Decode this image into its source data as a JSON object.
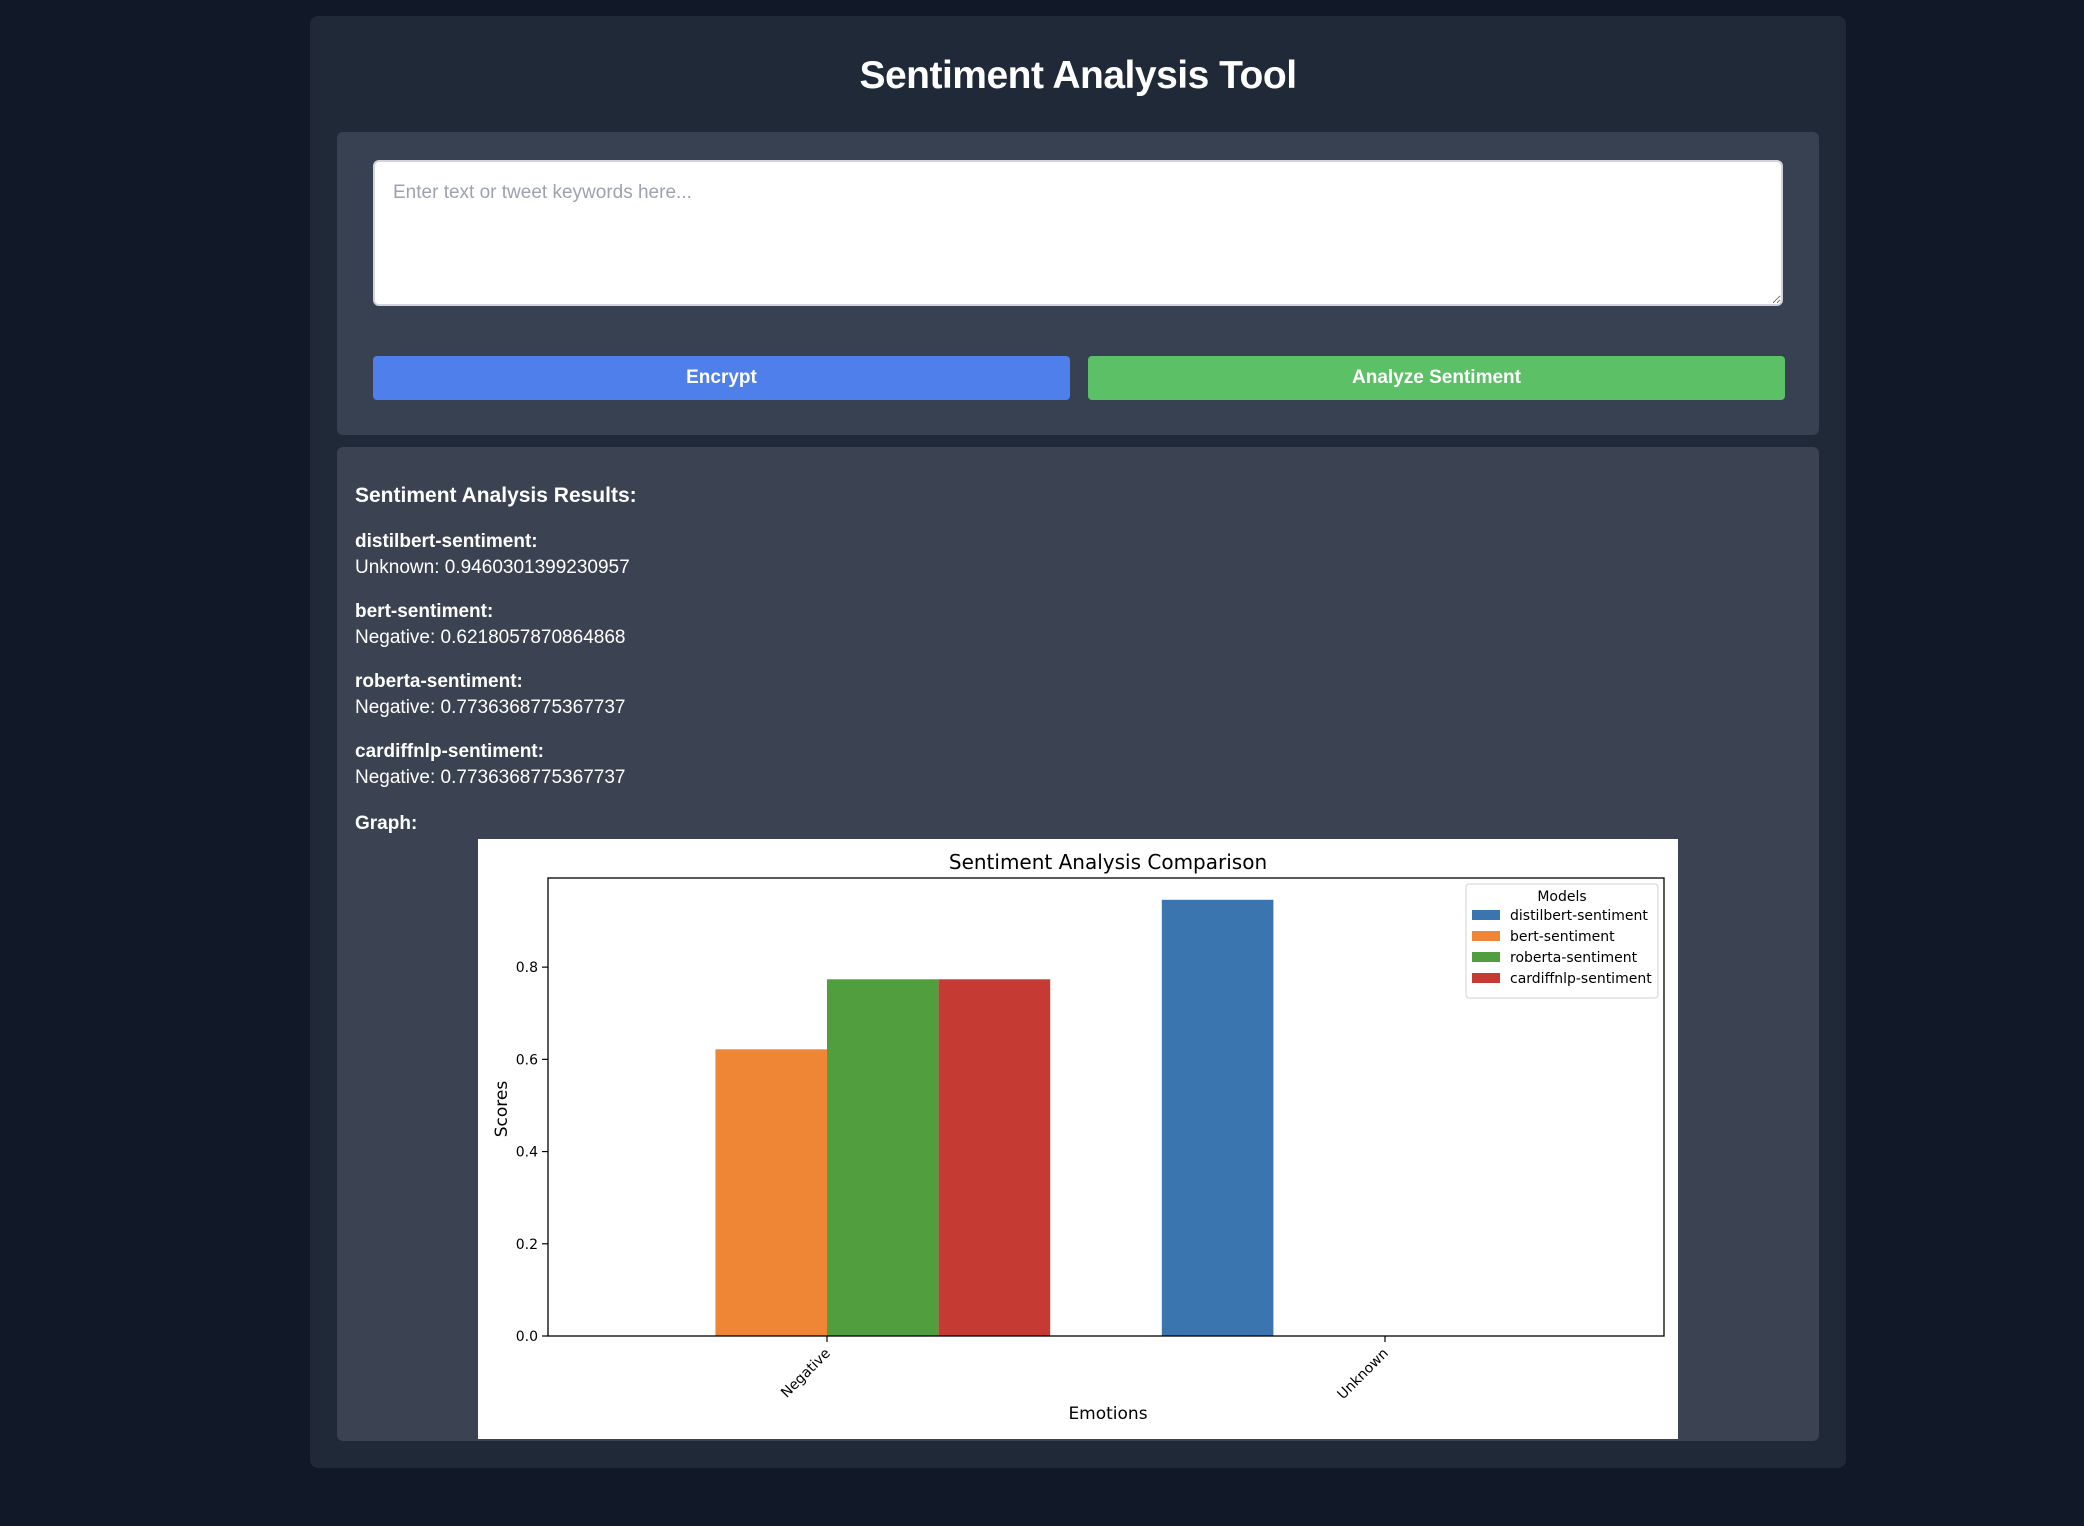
{
  "app": {
    "title": "Sentiment Analysis Tool"
  },
  "input": {
    "placeholder": "Enter text or tweet keywords here...",
    "value": ""
  },
  "buttons": {
    "encrypt": "Encrypt",
    "analyze": "Analyze Sentiment"
  },
  "results": {
    "title": "Sentiment Analysis Results:",
    "models": [
      {
        "name": "distilbert-sentiment:",
        "result": "Unknown: 0.9460301399230957"
      },
      {
        "name": "bert-sentiment:",
        "result": "Negative: 0.6218057870864868"
      },
      {
        "name": "roberta-sentiment:",
        "result": "Negative: 0.7736368775367737"
      },
      {
        "name": "cardiffnlp-sentiment:",
        "result": "Negative: 0.7736368775367737"
      }
    ],
    "graph_label": "Graph:"
  },
  "chart_data": {
    "type": "bar",
    "title": "Sentiment Analysis Comparison",
    "xlabel": "Emotions",
    "ylabel": "Scores",
    "categories": [
      "Negative",
      "Unknown"
    ],
    "ylim": [
      0,
      0.9933
    ],
    "yticks": [
      "0.0",
      "0.2",
      "0.4",
      "0.6",
      "0.8"
    ],
    "legend_title": "Models",
    "legend_position": "top-right",
    "grid": false,
    "series": [
      {
        "name": "distilbert-sentiment",
        "color": "#3a75af",
        "values": [
          null,
          0.9460301399230957
        ]
      },
      {
        "name": "bert-sentiment",
        "color": "#ef8636",
        "values": [
          0.6218057870864868,
          null
        ]
      },
      {
        "name": "roberta-sentiment",
        "color": "#519e3e",
        "values": [
          0.7736368775367737,
          null
        ]
      },
      {
        "name": "cardiffnlp-sentiment",
        "color": "#c53a32",
        "values": [
          0.7736368775367737,
          null
        ]
      }
    ]
  }
}
